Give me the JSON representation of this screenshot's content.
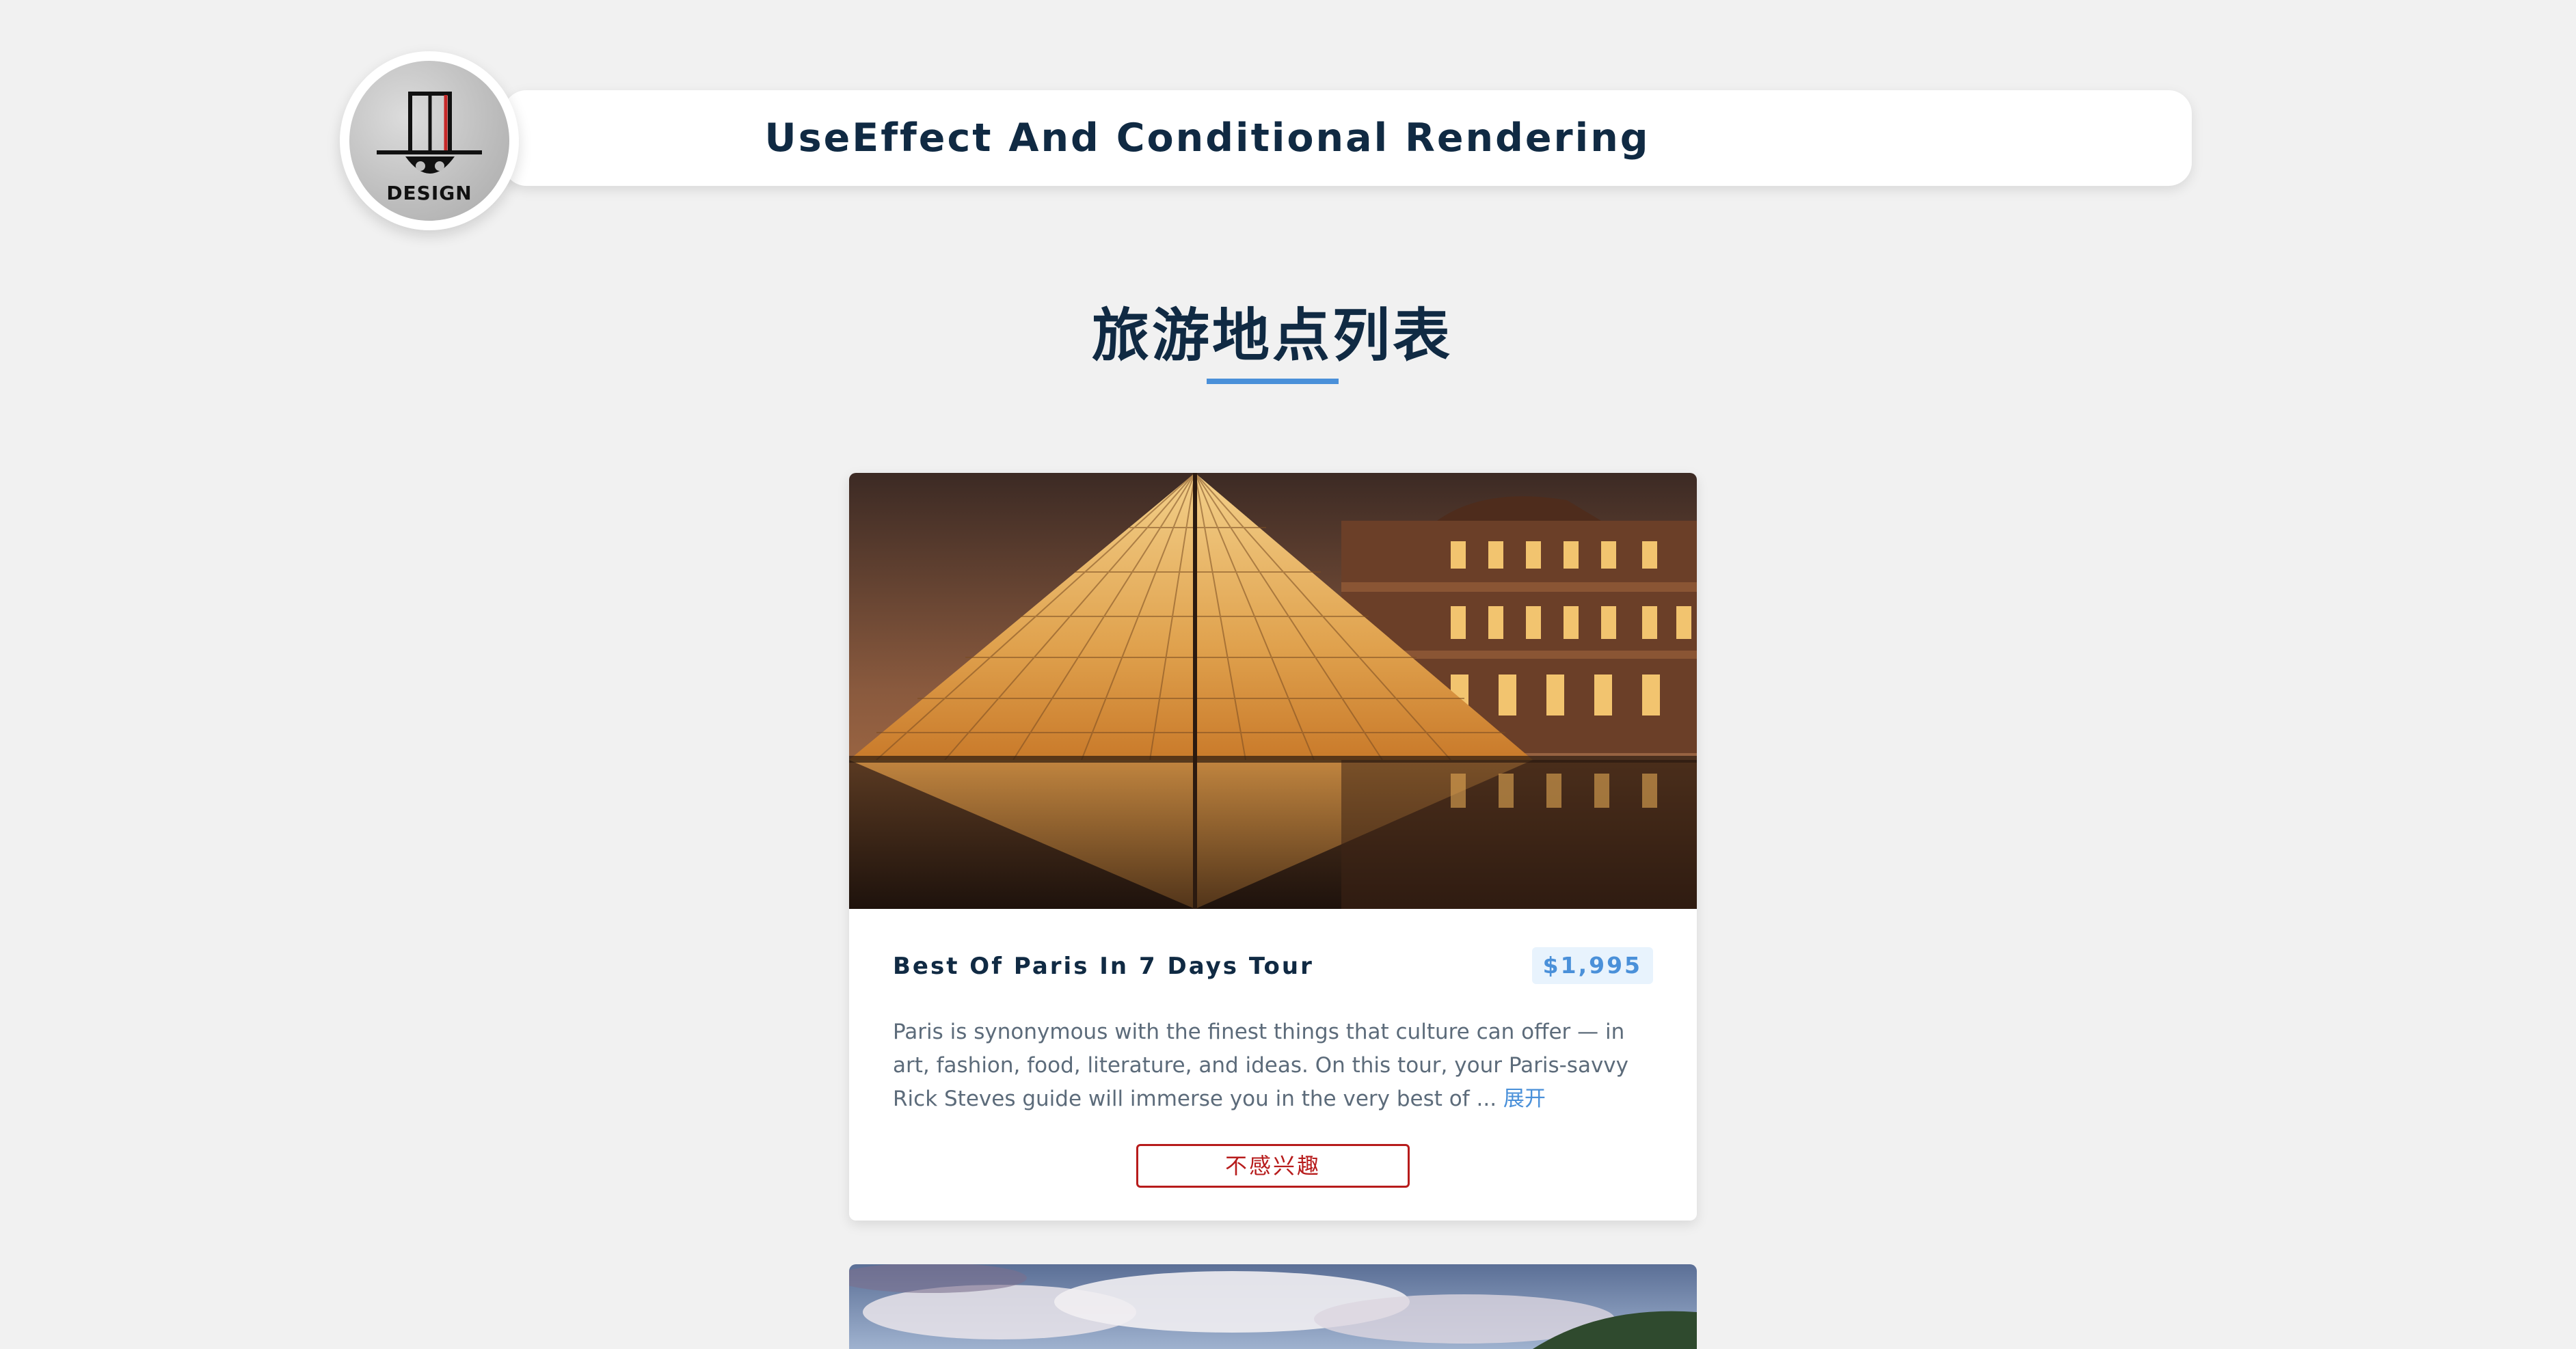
{
  "header": {
    "title": "UseEffect And Conditional Rendering",
    "logo_text": "DESIGN",
    "logo_icon": "design-logo"
  },
  "section": {
    "title": "旅游地点列表"
  },
  "tours": [
    {
      "name": "Best Of Paris In 7 Days Tour",
      "price": "$1,995",
      "info": "Paris is synonymous with the finest things that culture can offer — in art, fashion, food, literature, and ideas. On this tour, your Paris-savvy Rick Steves guide will immerse you in the very best of ...",
      "read_more_label": "展开",
      "not_interested_label": "不感兴趣",
      "image_icon": "louvre-pyramid-photo"
    }
  ],
  "next_tour": {
    "image_icon": "landscape-sky-photo"
  },
  "colors": {
    "page_bg": "#f1f1f1",
    "title": "#102a43",
    "accent": "#4a90d9",
    "price_bg": "#e8f3fd",
    "danger": "#b71c1c",
    "body_text": "#5c6b7a"
  }
}
